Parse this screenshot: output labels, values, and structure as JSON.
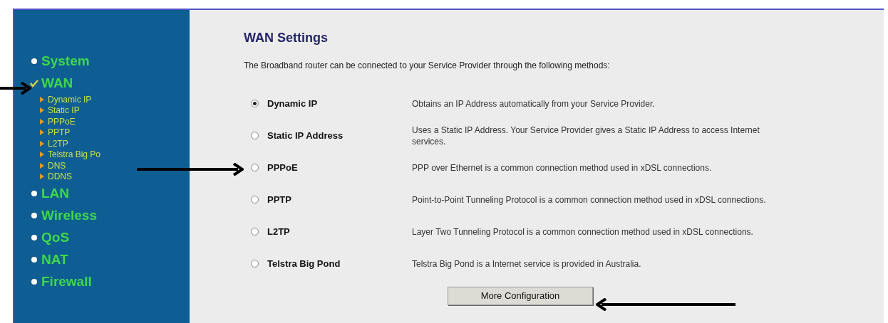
{
  "sidebar": {
    "items": [
      {
        "kind": "section",
        "label": "System",
        "selected": false
      },
      {
        "kind": "section",
        "label": "WAN",
        "selected": true
      },
      {
        "kind": "sub",
        "label": "Dynamic IP"
      },
      {
        "kind": "sub",
        "label": "Static IP"
      },
      {
        "kind": "sub",
        "label": "PPPoE"
      },
      {
        "kind": "sub",
        "label": "PPTP"
      },
      {
        "kind": "sub",
        "label": "L2TP"
      },
      {
        "kind": "sub",
        "label": "Telstra Big Po"
      },
      {
        "kind": "sub",
        "label": "DNS"
      },
      {
        "kind": "sub",
        "label": "DDNS"
      },
      {
        "kind": "section",
        "label": "LAN",
        "selected": false
      },
      {
        "kind": "section",
        "label": "Wireless",
        "selected": false
      },
      {
        "kind": "section",
        "label": "QoS",
        "selected": false
      },
      {
        "kind": "section",
        "label": "NAT",
        "selected": false
      },
      {
        "kind": "section",
        "label": "Firewall",
        "selected": false
      }
    ]
  },
  "content": {
    "title": "WAN Settings",
    "intro": "The Broadband router can be connected to your Service Provider through the following methods:",
    "methods": [
      {
        "label": "Dynamic IP",
        "selected": true,
        "description": "Obtains an IP Address automatically from your Service Provider."
      },
      {
        "label": "Static IP Address",
        "selected": false,
        "description": "Uses a Static IP Address. Your Service Provider gives a Static IP Address to access Internet services."
      },
      {
        "label": "PPPoE",
        "selected": false,
        "description": "PPP over Ethernet is a common connection method used in xDSL connections."
      },
      {
        "label": "PPTP",
        "selected": false,
        "description": "Point-to-Point Tunneling Protocol is a common connection method used in xDSL connections."
      },
      {
        "label": "L2TP",
        "selected": false,
        "description": "Layer Two Tunneling Protocol is a common connection method used in xDSL connections."
      },
      {
        "label": "Telstra Big Pond",
        "selected": false,
        "description": "Telstra Big Pond is a Internet service is provided in Australia."
      }
    ],
    "button": "More Configuration"
  }
}
